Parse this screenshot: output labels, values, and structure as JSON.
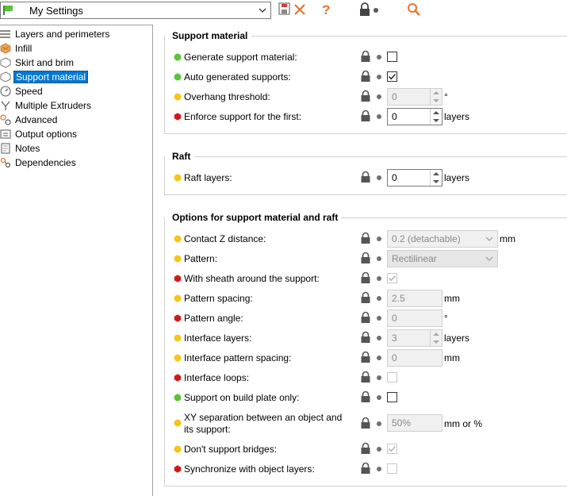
{
  "toolbar": {
    "preset_name": "My Settings",
    "icons": [
      "flag-icon",
      "chevron-down-icon",
      "save-icon",
      "delete-icon",
      "help-icon",
      "lock-icon",
      "dot-icon",
      "search-icon"
    ]
  },
  "tree": [
    {
      "label": "Layers and perimeters",
      "icon": "layers-icon"
    },
    {
      "label": "Infill",
      "icon": "infill-icon"
    },
    {
      "label": "Skirt and brim",
      "icon": "skirt-icon"
    },
    {
      "label": "Support material",
      "icon": "support-icon",
      "selected": true
    },
    {
      "label": "Speed",
      "icon": "speed-icon"
    },
    {
      "label": "Multiple Extruders",
      "icon": "extruders-icon"
    },
    {
      "label": "Advanced",
      "icon": "advanced-icon"
    },
    {
      "label": "Output options",
      "icon": "output-icon"
    },
    {
      "label": "Notes",
      "icon": "notes-icon"
    },
    {
      "label": "Dependencies",
      "icon": "dependencies-icon"
    }
  ],
  "groups": {
    "support": {
      "title": "Support material"
    },
    "raft": {
      "title": "Raft"
    },
    "options": {
      "title": "Options for support material and raft"
    }
  },
  "rows": {
    "generate_support": {
      "label": "Generate support material:",
      "mode": "simple",
      "checked": false
    },
    "auto_supports": {
      "label": "Auto generated supports:",
      "mode": "simple",
      "checked": true
    },
    "overhang": {
      "label": "Overhang threshold:",
      "mode": "advanced",
      "value": "0",
      "unit": "°"
    },
    "enforce": {
      "label": "Enforce support for the first:",
      "mode": "expert",
      "value": "0",
      "unit": "layers"
    },
    "raft_layers": {
      "label": "Raft layers:",
      "mode": "advanced",
      "value": "0",
      "unit": "layers"
    },
    "contact_z": {
      "label": "Contact Z distance:",
      "mode": "advanced",
      "value": "0.2 (detachable)",
      "unit": "mm"
    },
    "pattern": {
      "label": "Pattern:",
      "mode": "advanced",
      "value": "Rectilinear"
    },
    "sheath": {
      "label": "With sheath around the support:",
      "mode": "expert",
      "checked": true
    },
    "pattern_spacing": {
      "label": "Pattern spacing:",
      "mode": "advanced",
      "value": "2.5",
      "unit": "mm"
    },
    "pattern_angle": {
      "label": "Pattern angle:",
      "mode": "expert",
      "value": "0",
      "unit": "°"
    },
    "interface_layers": {
      "label": "Interface layers:",
      "mode": "advanced",
      "value": "3",
      "unit": "layers"
    },
    "interface_spacing": {
      "label": "Interface pattern spacing:",
      "mode": "advanced",
      "value": "0",
      "unit": "mm"
    },
    "interface_loops": {
      "label": "Interface loops:",
      "mode": "expert",
      "checked": false
    },
    "build_plate": {
      "label": "Support on build plate only:",
      "mode": "simple",
      "checked": false
    },
    "xy_sep": {
      "label_line1": "XY separation between an object and",
      "label_line2": "its support:",
      "mode": "advanced",
      "value": "50%",
      "unit": "mm or %"
    },
    "bridges": {
      "label": "Don't support bridges:",
      "mode": "advanced",
      "checked": true
    },
    "sync_layers": {
      "label": "Synchronize with object layers:",
      "mode": "expert",
      "checked": false
    }
  },
  "colors": {
    "simple": "#5ac33a",
    "advanced": "#f5c518",
    "expert": "#d01a1a",
    "selection": "#0078d7"
  }
}
